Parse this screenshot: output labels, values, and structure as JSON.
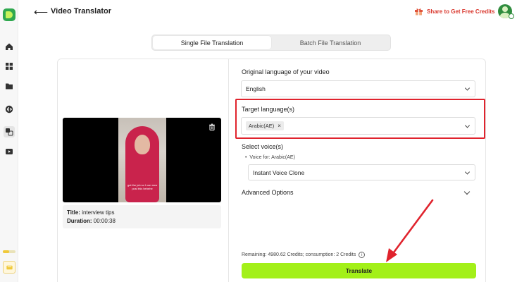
{
  "header": {
    "back_glyph": "⟵",
    "title": "Video Translator",
    "share_label": "Share to Get Free Credits"
  },
  "tabs": [
    {
      "label": "Single File Translation",
      "active": true
    },
    {
      "label": "Batch File Translation",
      "active": false
    }
  ],
  "video": {
    "subtitle_text": "got the job so I can now post this hehehe",
    "title_label": "Title:",
    "title_value": "interview tips",
    "duration_label": "Duration:",
    "duration_value": "00:00:38"
  },
  "form": {
    "original_language_label": "Original language of your video",
    "original_language_value": "English",
    "target_language_label": "Target language(s)",
    "target_language_tags": [
      "Arabic(AE)"
    ],
    "tag_remove_glyph": "×",
    "select_voice_label": "Select voice(s)",
    "voice_for_label": "Voice for: Arabic(AE)",
    "voice_value": "Instant Voice Clone",
    "advanced_options_label": "Advanced Options"
  },
  "footer": {
    "remaining_text": "Remaining: 4980.62 Credits; consumption: 2 Credits",
    "info_glyph": "i",
    "translate_label": "Translate"
  },
  "colors": {
    "accent_green": "#a3f019",
    "highlight_red": "#e0232d",
    "share_red": "#d9362c"
  }
}
